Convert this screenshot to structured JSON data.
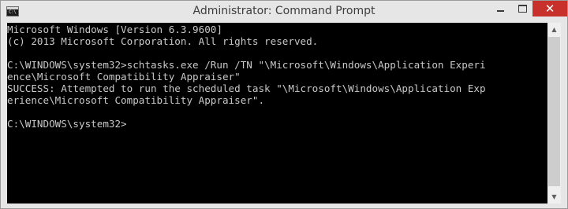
{
  "window": {
    "title": "Administrator: Command Prompt",
    "icon": "cmd-icon",
    "icon_text": "C:\\",
    "close_color": "#c7302b"
  },
  "controls": {
    "minimize": "minimize-icon",
    "maximize": "maximize-icon",
    "close": "close-icon",
    "close_glyph": "✕"
  },
  "console": {
    "background": "#000000",
    "foreground": "#c0c0c0",
    "lines": [
      "Microsoft Windows [Version 6.3.9600]",
      "(c) 2013 Microsoft Corporation. All rights reserved.",
      "",
      "C:\\WINDOWS\\system32>schtasks.exe /Run /TN \"\\Microsoft\\Windows\\Application Experi",
      "ence\\Microsoft Compatibility Appraiser\"",
      "SUCCESS: Attempted to run the scheduled task \"\\Microsoft\\Windows\\Application Exp",
      "erience\\Microsoft Compatibility Appraiser\".",
      "",
      "C:\\WINDOWS\\system32>"
    ]
  },
  "scrollbar": {
    "up_glyph": "▲",
    "down_glyph": "▼"
  }
}
